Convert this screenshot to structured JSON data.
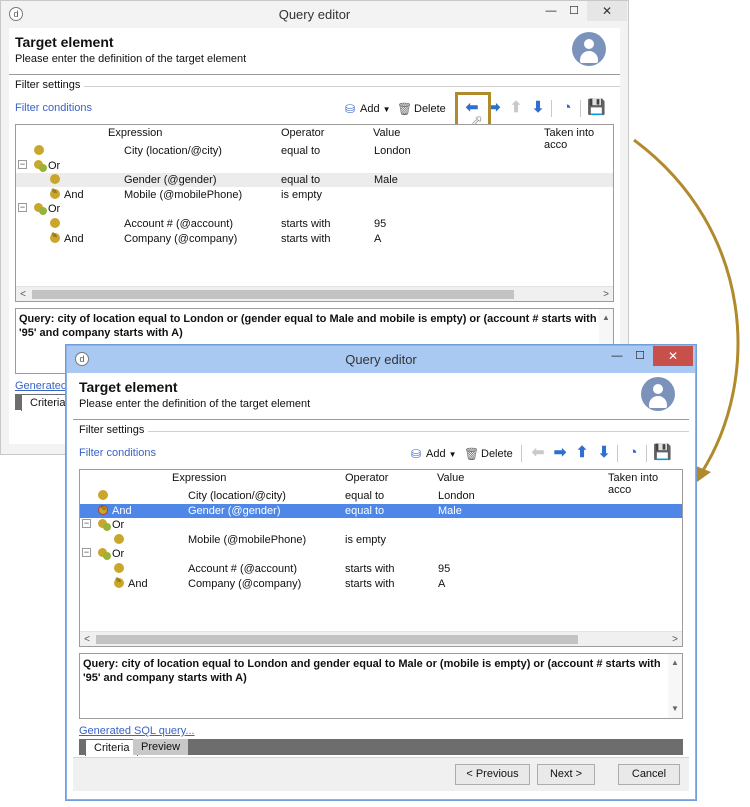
{
  "colors": {
    "accent_arrow": "#b08a2c",
    "selection": "#4e87e7",
    "link": "#3a63c6",
    "close_button": "#c7504a"
  },
  "window_back": {
    "title": "Query editor",
    "header_title": "Target element",
    "header_subtitle": "Please enter the definition of the target element",
    "filter_settings_label": "Filter settings",
    "filter_conditions_link": "Filter conditions",
    "toolbar": {
      "add_label": "Add",
      "delete_label": "Delete"
    },
    "columns": [
      "Expression",
      "Operator",
      "Value",
      "Taken into acco"
    ],
    "rows": [
      {
        "logic": "",
        "expression": "City (location/@city)",
        "operator": "equal to",
        "value": "London"
      },
      {
        "logic": "Or",
        "expression": "",
        "operator": "",
        "value": ""
      },
      {
        "logic": "",
        "expression": "Gender (@gender)",
        "operator": "equal to",
        "value": "Male"
      },
      {
        "logic": "And",
        "expression": "Mobile (@mobilePhone)",
        "operator": "is empty",
        "value": ""
      },
      {
        "logic": "Or",
        "expression": "",
        "operator": "",
        "value": ""
      },
      {
        "logic": "",
        "expression": "Account # (@account)",
        "operator": "starts with",
        "value": "95"
      },
      {
        "logic": "And",
        "expression": "Company (@company)",
        "operator": "starts with",
        "value": "A"
      }
    ],
    "query_text": "Query: city of location equal to London or (gender equal to Male and mobile is empty) or (account # starts with '95' and company starts with A)",
    "sql_link": "Generated S",
    "tab_criteria": "Criteria"
  },
  "window_front": {
    "title": "Query editor",
    "header_title": "Target element",
    "header_subtitle": "Please enter the definition of the target element",
    "filter_settings_label": "Filter settings",
    "filter_conditions_link": "Filter conditions",
    "toolbar": {
      "add_label": "Add",
      "delete_label": "Delete"
    },
    "columns": [
      "Expression",
      "Operator",
      "Value",
      "Taken into acco"
    ],
    "rows": [
      {
        "logic": "",
        "expression": "City (location/@city)",
        "operator": "equal to",
        "value": "London"
      },
      {
        "logic": "And",
        "expression": "Gender (@gender)",
        "operator": "equal to",
        "value": "Male"
      },
      {
        "logic": "Or",
        "expression": "",
        "operator": "",
        "value": ""
      },
      {
        "logic": "",
        "expression": "Mobile (@mobilePhone)",
        "operator": "is empty",
        "value": ""
      },
      {
        "logic": "Or",
        "expression": "",
        "operator": "",
        "value": ""
      },
      {
        "logic": "",
        "expression": "Account # (@account)",
        "operator": "starts with",
        "value": "95"
      },
      {
        "logic": "And",
        "expression": "Company (@company)",
        "operator": "starts with",
        "value": "A"
      }
    ],
    "query_text": "Query: city of location equal to London and gender equal to Male or (mobile is empty) or (account # starts with '95' and company starts with A)",
    "sql_link": "Generated SQL query...",
    "tab_criteria": "Criteria",
    "tab_preview": "Preview",
    "btn_previous": "< Previous",
    "btn_next": "Next >",
    "btn_cancel": "Cancel"
  }
}
